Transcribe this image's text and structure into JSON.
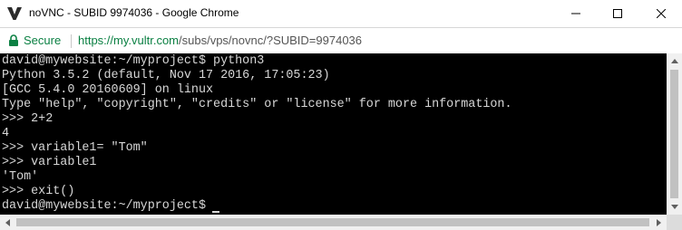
{
  "window": {
    "title": "noVNC - SUBID 9974036 - Google Chrome",
    "app_icon": "vultr-v-icon",
    "controls": [
      "minimize-icon",
      "maximize-icon",
      "close-icon"
    ]
  },
  "addressbar": {
    "secure_label": "Secure",
    "url_host": "https://my.vultr.com",
    "url_path": "/subs/vps/novnc/?SUBID=9974036",
    "icon": "lock-icon",
    "secure_color": "#0b8043"
  },
  "terminal": {
    "background": "#000000",
    "foreground": "#d8d8d8",
    "lines": [
      "david@mywebsite:~/myproject$ python3",
      "Python 3.5.2 (default, Nov 17 2016, 17:05:23)",
      "[GCC 5.4.0 20160609] on linux",
      "Type \"help\", \"copyright\", \"credits\" or \"license\" for more information.",
      ">>> 2+2",
      "4",
      ">>> variable1= \"Tom\"",
      ">>> variable1",
      "'Tom'",
      ">>> exit()",
      "david@mywebsite:~/myproject$"
    ]
  },
  "scrollbars": {
    "icons": [
      "arrow-up-icon",
      "arrow-down-icon",
      "arrow-left-icon",
      "arrow-right-icon"
    ]
  }
}
